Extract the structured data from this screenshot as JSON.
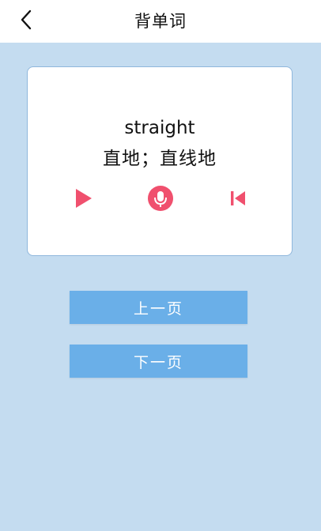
{
  "header": {
    "title": "背单词",
    "back_icon": "chevron-left-icon"
  },
  "card": {
    "word": "straight",
    "meaning": "直地；直线地",
    "controls": {
      "play_icon": "play-icon",
      "mic_icon": "microphone-icon",
      "restart_icon": "skip-back-icon"
    }
  },
  "buttons": {
    "prev_label": "上一页",
    "next_label": "下一页"
  },
  "colors": {
    "background": "#c4dcf0",
    "accent": "#f0506e",
    "button": "#6aafe8",
    "card_border": "#8fb7dc"
  }
}
